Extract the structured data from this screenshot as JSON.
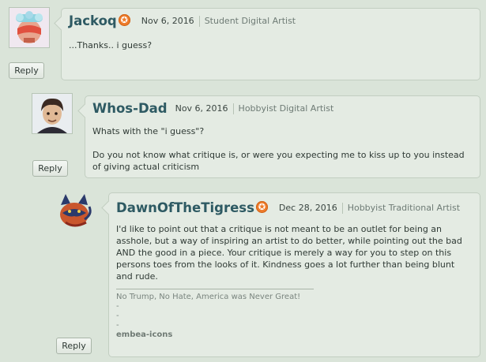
{
  "comments": [
    {
      "username": "Jackoq",
      "badge_icon": "premium-badge-icon",
      "date": "Nov 6, 2016",
      "role": "Student Digital Artist",
      "body": [
        "...Thanks.. i guess?"
      ],
      "reply_label": "Reply"
    },
    {
      "username": "Whos-Dad",
      "date": "Nov 6, 2016",
      "role": "Hobbyist Digital Artist",
      "body": [
        "Whats with the \"i guess\"?",
        "Do you not know what critique is, or were you expecting me to kiss up to you instead of giving actual criticism"
      ],
      "reply_label": "Reply"
    },
    {
      "username": "DawnOfTheTigress",
      "badge_icon": "premium-badge-icon",
      "date": "Dec 28, 2016",
      "role": "Hobbyist Traditional Artist",
      "body": [
        "I'd like to point out that a critique is not meant to be an outlet for being an asshole, but a way of inspiring an artist to do better, while pointing out the bad AND the good in a piece. Your critique is merely a way for you to step on this persons toes from the looks of it. Kindness goes a lot further than being blunt and rude."
      ],
      "signature": {
        "line1": "No Trump, No Hate, America was Never Great!",
        "line2": "-",
        "line3": "-",
        "line4": "-",
        "footer": "embea-icons"
      },
      "reply_label": "Reply"
    }
  ],
  "colors": {
    "background": "#dae4d9",
    "bubble": "#e4ebe3",
    "username": "#2e5a63",
    "badge": "#ee7b2a"
  }
}
